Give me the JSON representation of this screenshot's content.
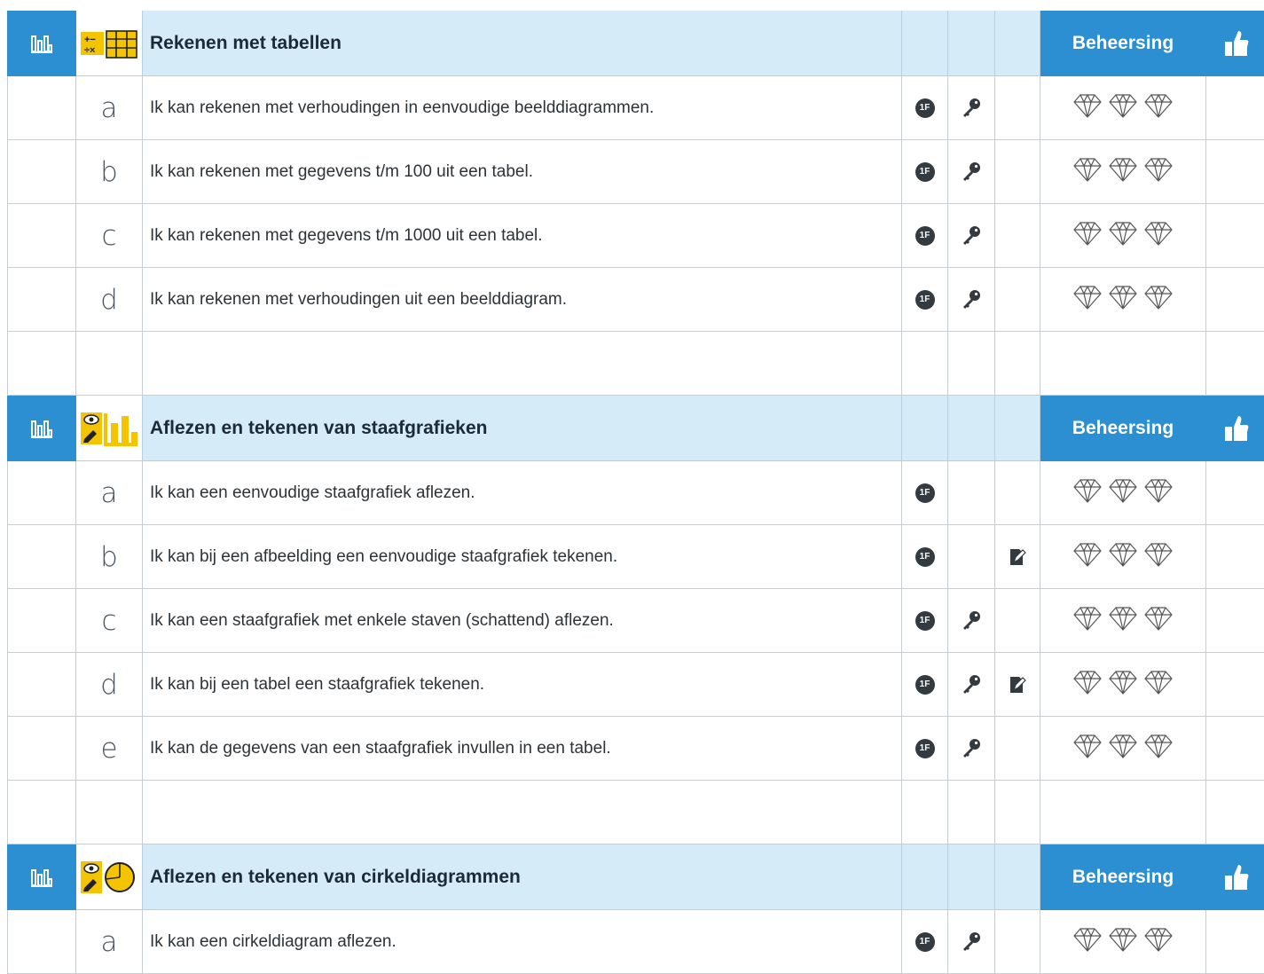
{
  "sections": [
    {
      "title": "Rekenen met tabellen",
      "beheersing": "Beheersing",
      "topic_icon": "calculator-table-icon",
      "rows": [
        {
          "letter": "a",
          "text": "Ik kan rekenen met verhoudingen in eenvoudige beelddiagrammen.",
          "level": "1F",
          "key": true,
          "edit": false
        },
        {
          "letter": "b",
          "text": "Ik kan rekenen met gegevens t/m 100 uit een tabel.",
          "level": "1F",
          "key": true,
          "edit": false
        },
        {
          "letter": "c",
          "text": "Ik kan rekenen met gegevens t/m 1000 uit een tabel.",
          "level": "1F",
          "key": true,
          "edit": false
        },
        {
          "letter": "d",
          "text": "Ik kan rekenen met verhoudingen uit een beelddiagram.",
          "level": "1F",
          "key": true,
          "edit": false
        }
      ]
    },
    {
      "title": "Aflezen en tekenen van staafgrafieken",
      "beheersing": "Beheersing",
      "topic_icon": "read-draw-bar-chart-icon",
      "rows": [
        {
          "letter": "a",
          "text": "Ik kan een eenvoudige staafgrafiek aflezen.",
          "level": "1F",
          "key": false,
          "edit": false
        },
        {
          "letter": "b",
          "text": "Ik kan bij een afbeelding een eenvoudige staafgrafiek tekenen.",
          "level": "1F",
          "key": false,
          "edit": true
        },
        {
          "letter": "c",
          "text": "Ik kan een staafgrafiek met enkele staven (schattend) aflezen.",
          "level": "1F",
          "key": true,
          "edit": false
        },
        {
          "letter": "d",
          "text": "Ik kan bij een tabel een staafgrafiek tekenen.",
          "level": "1F",
          "key": true,
          "edit": true
        },
        {
          "letter": "e",
          "text": "Ik kan de gegevens van een staafgrafiek invullen in een tabel.",
          "level": "1F",
          "key": true,
          "edit": false
        }
      ]
    },
    {
      "title": "Aflezen en tekenen van cirkeldiagrammen",
      "beheersing": "Beheersing",
      "topic_icon": "read-draw-pie-chart-icon",
      "rows": [
        {
          "letter": "a",
          "text": "Ik kan een cirkeldiagram aflezen.",
          "level": "1F",
          "key": true,
          "edit": false
        }
      ]
    }
  ],
  "colors": {
    "accent": "#2b8fd2",
    "header_bg": "#d6ebf8",
    "topic_yellow": "#f5c400"
  }
}
